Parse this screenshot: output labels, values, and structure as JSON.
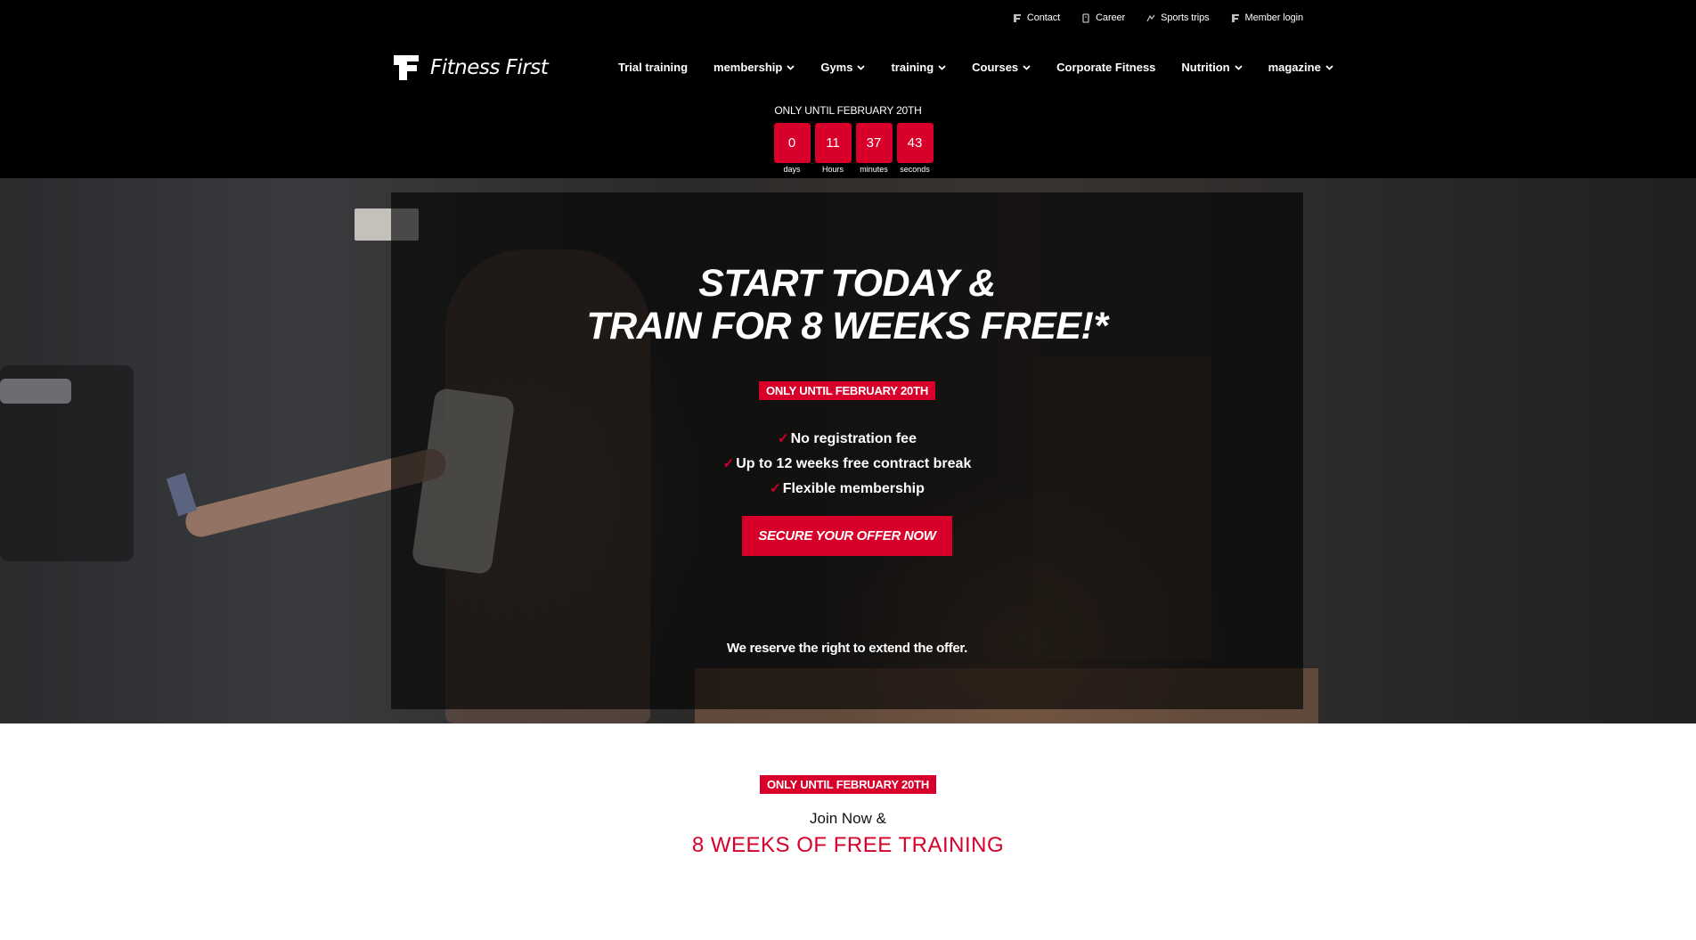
{
  "utility": {
    "links": [
      {
        "label": "Contact",
        "icon": "logo-f-icon"
      },
      {
        "label": "Career",
        "icon": "career-icon"
      },
      {
        "label": "Sports trips",
        "icon": "trips-icon"
      },
      {
        "label": "Member login",
        "icon": "logo-f-icon"
      }
    ]
  },
  "header": {
    "logo_text": "Fitness First",
    "nav": [
      {
        "label": "Trial training"
      },
      {
        "label": "membership"
      },
      {
        "label": "Gyms"
      },
      {
        "label": "training"
      },
      {
        "label": "Courses"
      },
      {
        "label": "Corporate Fitness"
      },
      {
        "label": "Nutrition"
      },
      {
        "label": "magazine"
      }
    ],
    "countdown": {
      "label": "ONLY UNTIL FEBRUARY 20TH",
      "units": [
        {
          "value": "0",
          "caption": "days"
        },
        {
          "value": "11",
          "caption": "Hours"
        },
        {
          "value": "37",
          "caption": "minutes"
        },
        {
          "value": "43",
          "caption": "seconds"
        }
      ]
    }
  },
  "hero": {
    "title_line1": "START TODAY &",
    "title_line2": "TRAIN FOR 8 WEEKS FREE!*",
    "badge": "ONLY UNTIL FEBRUARY 20TH",
    "benefits": [
      {
        "check": "✓",
        "text": "No registration fee"
      },
      {
        "check": "✓",
        "text": "Up to 12 weeks free contract break"
      },
      {
        "check": "✓",
        "text": "Flexible membership"
      }
    ],
    "cta": "SECURE YOUR OFFER NOW",
    "disclaimer": "We reserve the right to extend the offer."
  },
  "promo": {
    "badge": "ONLY UNTIL FEBRUARY 20TH",
    "join": "Join Now &",
    "headline": "8 WEEKS OF FREE TRAINING"
  },
  "colors": {
    "brand_red": "#d8002a",
    "header_bg": "#000000"
  }
}
